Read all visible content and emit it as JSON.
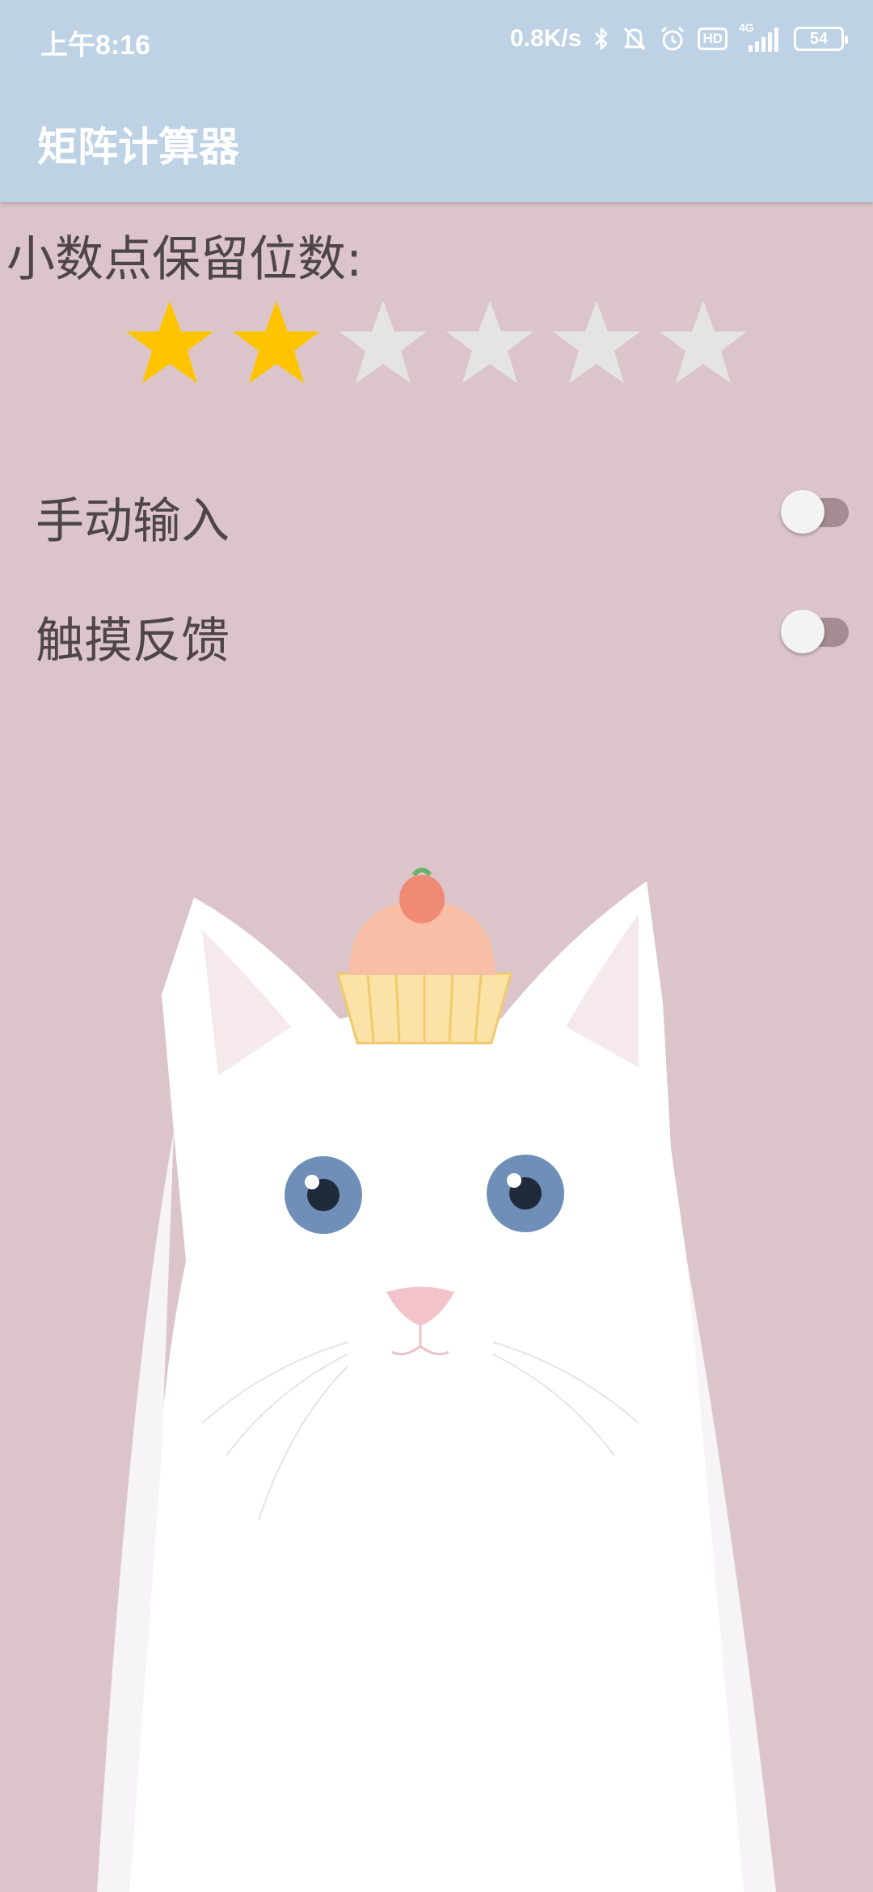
{
  "status_bar": {
    "time": "上午8:16",
    "network_speed": "0.8K/s",
    "hd_badge": "HD",
    "network_type": "4G",
    "battery": "54"
  },
  "app_bar": {
    "title": "矩阵计算器"
  },
  "decimal_places": {
    "label": "小数点保留位数:",
    "rating": 2,
    "max": 6,
    "filled_color": "#ffc400",
    "empty_color": "#e4e4e4"
  },
  "settings": [
    {
      "label": "手动输入",
      "enabled": false
    },
    {
      "label": "触摸反馈",
      "enabled": false
    }
  ],
  "colors": {
    "app_bar": "#bdd2e4",
    "background": "#dcc5ca",
    "text": "#4d4547"
  }
}
